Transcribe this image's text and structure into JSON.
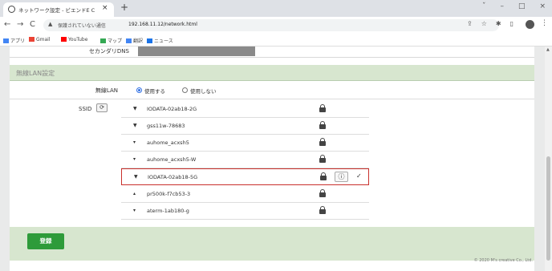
{
  "browser": {
    "tab_title": "ネットワーク設定 - ビエンドE C",
    "tab_close": "×",
    "new_tab": "+",
    "window_controls": [
      "ˇ",
      "–",
      "□",
      "×"
    ],
    "nav": {
      "back": "←",
      "forward": "→",
      "reload": "C"
    },
    "insecure_label": "保護されていない通信",
    "url": "192.168.11.12/network.html",
    "toolbar_icons": [
      "share-icon",
      "star-icon",
      "extension-icon",
      "sidebar-icon"
    ],
    "menu": "⋮",
    "bookmarks": [
      {
        "label": "アプリ",
        "icon": "apps-grid-icon",
        "color": "#4285f4"
      },
      {
        "label": "Gmail",
        "icon": "gmail-icon",
        "color": "#ea4335"
      },
      {
        "label": "YouTube",
        "icon": "youtube-icon",
        "color": "#ff0000"
      },
      {
        "label": "マップ",
        "icon": "maps-icon",
        "color": "#34a853"
      },
      {
        "label": "翻訳",
        "icon": "translate-icon",
        "color": "#4285f4"
      },
      {
        "label": "ニュース",
        "icon": "news-icon",
        "color": "#1a73e8"
      }
    ]
  },
  "form": {
    "secondary_dns_label": "セカンダリDNS",
    "wireless_section_title": "無線LAN設定",
    "wireless_lan_label": "無線LAN",
    "wireless_on_label": "使用する",
    "wireless_off_label": "使用しない",
    "wireless_selected": "使用する",
    "ssid_label": "SSID",
    "refresh_icon": "⟳",
    "ssids": [
      {
        "name": "IODATA-02ab18-2G",
        "signal_icon": "▼",
        "locked": true,
        "selected": false
      },
      {
        "name": "gss11w-78683",
        "signal_icon": "▼",
        "locked": true,
        "selected": false
      },
      {
        "name": "auhome_acxsh5",
        "signal_icon": "▾",
        "locked": true,
        "selected": false
      },
      {
        "name": "auhome_acxsh5-W",
        "signal_icon": "▾",
        "locked": true,
        "selected": false
      },
      {
        "name": "IODATA-02ab18-5G",
        "signal_icon": "▼",
        "locked": true,
        "selected": true
      },
      {
        "name": "pr500k-f7cb53-3",
        "signal_icon": "▴",
        "locked": true,
        "selected": false
      },
      {
        "name": "aterm-1ab180-g",
        "signal_icon": "▾",
        "locked": true,
        "selected": false
      }
    ],
    "info_icon": "ⓘ",
    "check_mark": "✓",
    "register_button": "登録",
    "copyright": "© 2020 M's creative Co., Ltd."
  },
  "colors": {
    "section_green": "#d7e6cf",
    "register_green": "#2e9b3a",
    "selection_red": "#c9302c",
    "radio_blue": "#2f6fe4"
  }
}
